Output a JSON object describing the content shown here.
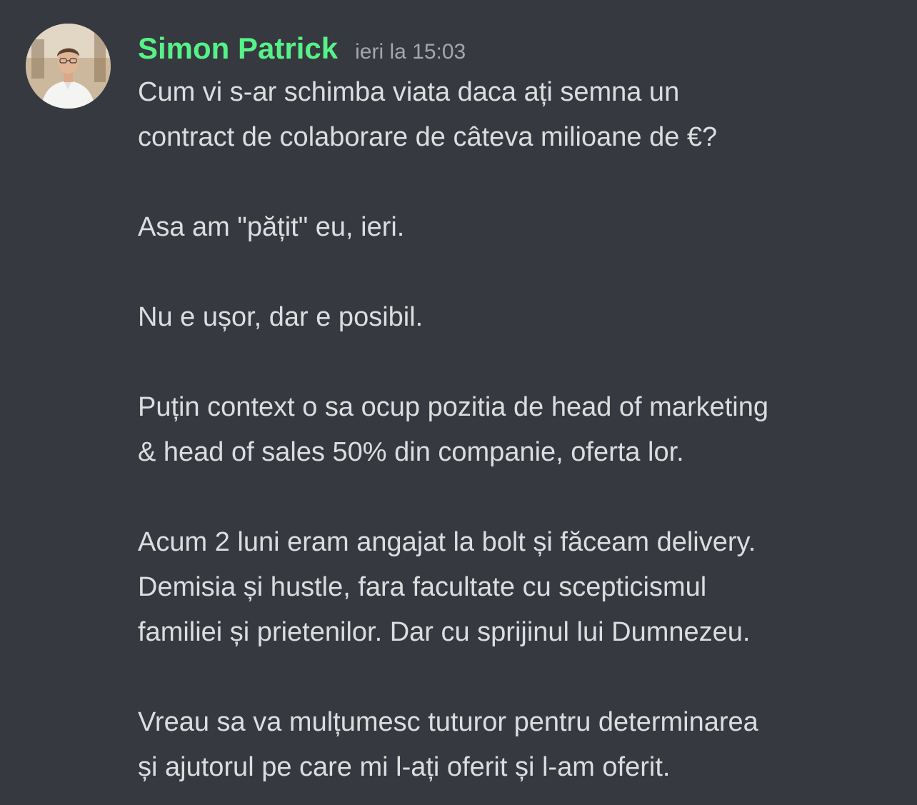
{
  "message": {
    "username": "Simon Patrick",
    "username_color": "#57f287",
    "timestamp": "ieri la 15:03",
    "avatar": {
      "icon": "user-avatar"
    },
    "lines": [
      "Cum vi s-ar schimba viata daca ați semna un",
      "contract de colaborare de câteva milioane de €?",
      "",
      "Asa am \"pățit\" eu, ieri.",
      "",
      "Nu e ușor, dar e posibil.",
      "",
      "Puțin context o sa ocup pozitia de head of marketing",
      "& head of sales 50% din companie, oferta lor.",
      "",
      "Acum 2 luni eram angajat la bolt și făceam delivery.",
      "Demisia și hustle, fara facultate cu scepticismul",
      "familiei și prietenilor. Dar cu sprijinul lui Dumnezeu.",
      "",
      "Vreau sa va mulțumesc tuturor pentru determinarea",
      "și ajutorul pe care mi l-ați oferit și l-am oferit."
    ]
  },
  "colors": {
    "background": "#36393f",
    "text": "#dcddde",
    "timestamp": "#a3a6aa"
  }
}
